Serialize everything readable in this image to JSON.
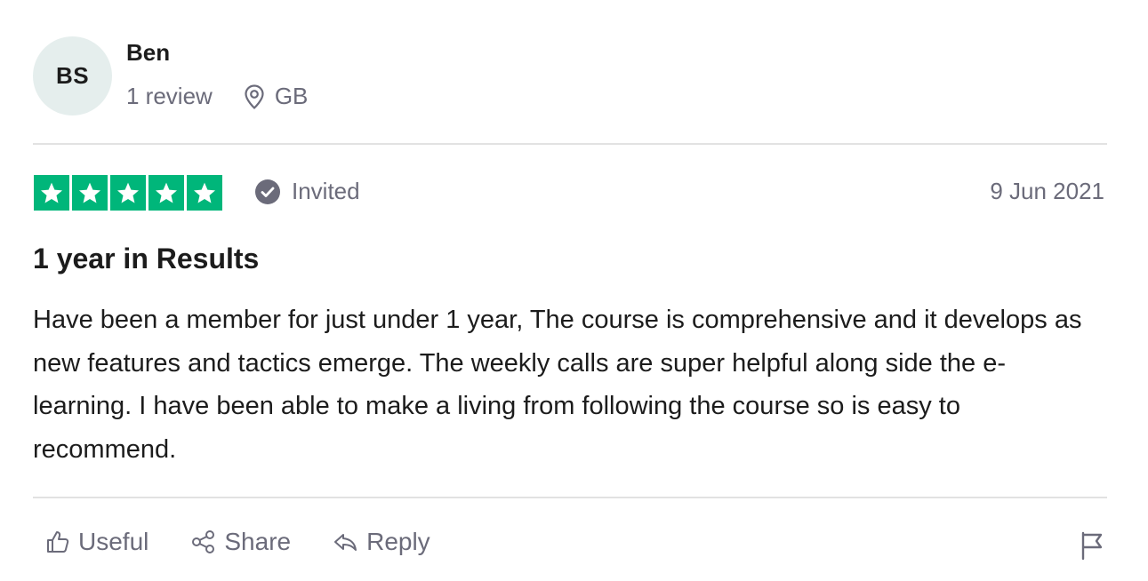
{
  "reviewer": {
    "initials": "BS",
    "name": "Ben",
    "review_count": "1 review",
    "location": "GB"
  },
  "rating": {
    "stars": 5,
    "max": 5,
    "color": "#00b67a"
  },
  "status": {
    "label": "Invited"
  },
  "date": "9 Jun 2021",
  "review": {
    "title": "1 year in Results",
    "body": "Have been a member for just under 1 year, The course is comprehensive and it develops as new features and tactics emerge. The weekly calls are super helpful along side the e-learning. I have been able to make a living from following the course so is easy to recommend."
  },
  "actions": {
    "useful_label": "Useful",
    "share_label": "Share",
    "reply_label": "Reply"
  },
  "icons": {
    "location": "location-pin-icon",
    "invited": "check-circle-icon",
    "useful": "thumbs-up-icon",
    "share": "share-icon",
    "reply": "reply-icon",
    "report": "flag-icon"
  }
}
